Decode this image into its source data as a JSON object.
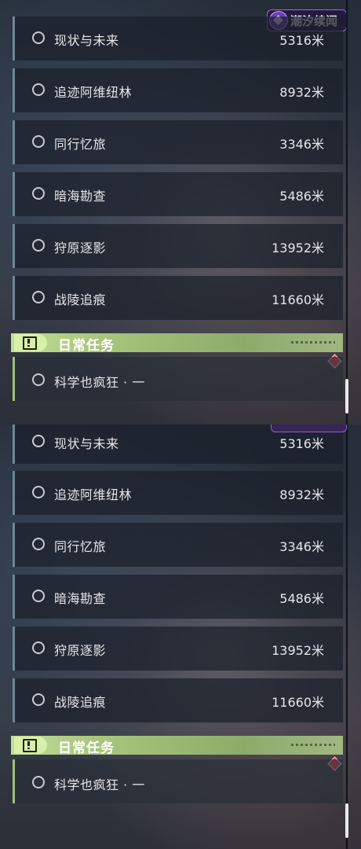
{
  "logo": {
    "text": "潮汐续闻",
    "accent": "#9a6adf"
  },
  "quest_list": [
    {
      "title": "现状与未来",
      "distance": "5316米"
    },
    {
      "title": "追迹阿维纽林",
      "distance": "8932米"
    },
    {
      "title": "同行忆旅",
      "distance": "3346米"
    },
    {
      "title": "暗海勘查",
      "distance": "5486米"
    },
    {
      "title": "狩原逐影",
      "distance": "13952米"
    },
    {
      "title": "战陵追痕",
      "distance": "11660米"
    }
  ],
  "daily_section": {
    "label": "日常任务",
    "icon": "exclamation-box-icon",
    "accent": "#b5d27f"
  },
  "daily_items": [
    {
      "title": "科学也疯狂 · 一"
    }
  ],
  "colors": {
    "row_border": "#6f8796",
    "daily_border": "#9ec07a",
    "marker": "#d94055"
  }
}
